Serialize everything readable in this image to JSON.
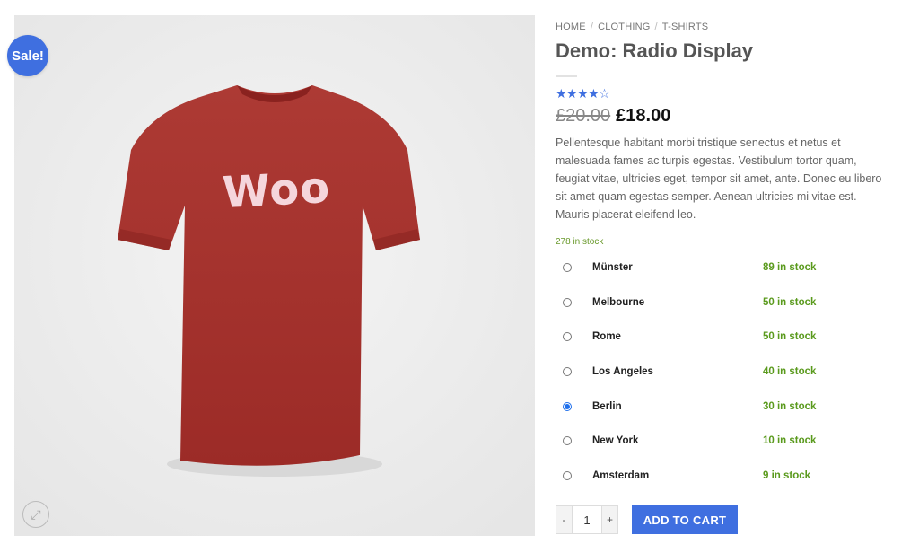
{
  "badge": {
    "sale_label": "Sale!"
  },
  "gallery": {
    "shirt_text": "Woo",
    "shirt_color": "#a3302b",
    "zoom_icon": "expand-icon"
  },
  "breadcrumb": {
    "items": [
      "HOME",
      "CLOTHING",
      "T-SHIRTS"
    ],
    "separator": "/"
  },
  "product": {
    "title": "Demo: Radio Display",
    "rating_stars": "★★★★☆",
    "old_price": "£20.00",
    "price": "£18.00",
    "description": "Pellentesque habitant morbi tristique senectus et netus et malesuada fames ac turpis egestas. Vestibulum tortor quam, feugiat vitae, ultricies eget, tempor sit amet, ante. Donec eu libero sit amet quam egestas semper. Aenean ultricies mi vitae est. Mauris placerat eleifend leo.",
    "stock_total": "278 in stock"
  },
  "variations": [
    {
      "location": "Münster",
      "stock": "89 in stock",
      "selected": false
    },
    {
      "location": "Melbourne",
      "stock": "50 in stock",
      "selected": false
    },
    {
      "location": "Rome",
      "stock": "50 in stock",
      "selected": false
    },
    {
      "location": "Los Angeles",
      "stock": "40 in stock",
      "selected": false
    },
    {
      "location": "Berlin",
      "stock": "30 in stock",
      "selected": true
    },
    {
      "location": "New York",
      "stock": "10 in stock",
      "selected": false
    },
    {
      "location": "Amsterdam",
      "stock": "9 in stock",
      "selected": false
    }
  ],
  "cart": {
    "minus": "-",
    "quantity": "1",
    "plus": "+",
    "add_label": "ADD TO CART"
  },
  "colors": {
    "accent": "#3f6fe0",
    "in_stock": "#5a9a1d"
  }
}
